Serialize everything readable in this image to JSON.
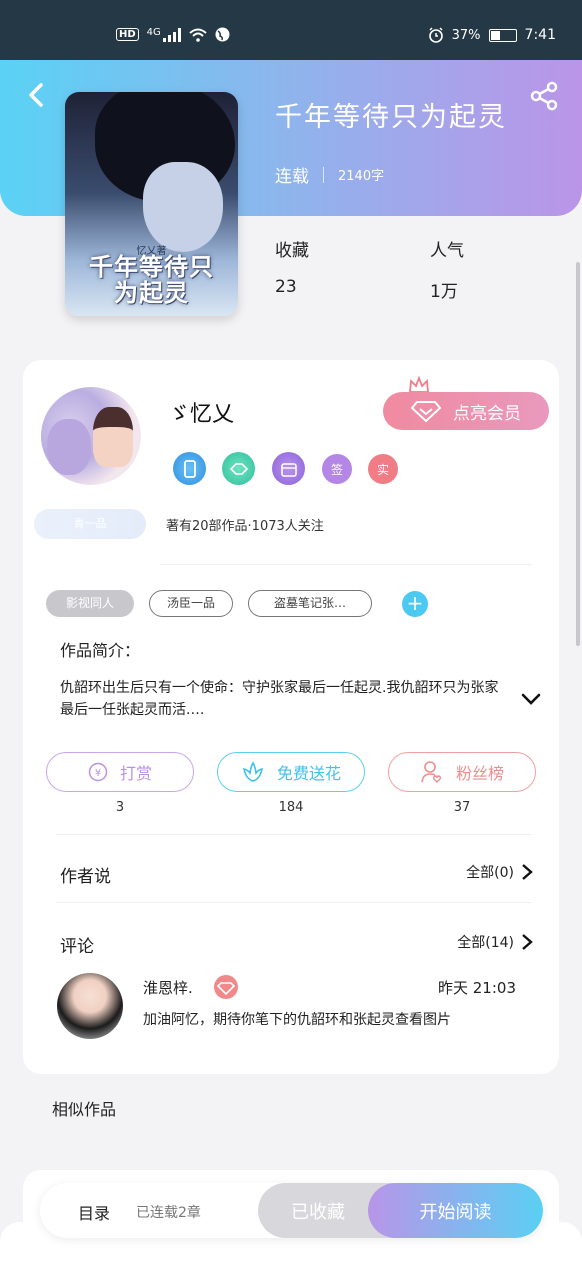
{
  "status_bar": {
    "hd": "HD",
    "network": "4G",
    "battery": "37%",
    "time": "7:41"
  },
  "book": {
    "title": "千年等待只为起灵",
    "status": "连载",
    "word_count": "2140字",
    "cover_small_text": "忆乂著",
    "cover_title": "千年等待只为起灵",
    "stats": [
      {
        "label": "收藏",
        "value": "23"
      },
      {
        "label": "人气",
        "value": "1万"
      }
    ]
  },
  "author": {
    "name": "ゞ忆乂",
    "vip_button": "点亮会员",
    "medals": [
      "签",
      "实"
    ],
    "level_badge": "青一品",
    "summary": "著有20部作品·1073人关注"
  },
  "tags": [
    "影视同人",
    "汤臣一品",
    "盗墓笔记张…"
  ],
  "intro": {
    "label": "作品简介：",
    "text": "仇韶环出生后只有一个使命：守护张家最后一任起灵.我仇韶环只为张家最后一任张起灵而活.…"
  },
  "actions": [
    {
      "label": "打赏",
      "count": "3"
    },
    {
      "label": "免费送花",
      "count": "184"
    },
    {
      "label": "粉丝榜",
      "count": "37"
    }
  ],
  "author_says": {
    "label": "作者说",
    "link": "全部(0)"
  },
  "comments": {
    "label": "评论",
    "link": "全部(14)",
    "items": [
      {
        "name": "淮恩梓.",
        "time": "昨天 21:03",
        "text": "加油阿忆，期待你笔下的仇韶环和张起灵查看图片"
      }
    ]
  },
  "similar": {
    "label": "相似作品"
  },
  "bottom_bar": {
    "toc": "目录",
    "chapters": "已连载2章",
    "collected": "已收藏",
    "read": "开始阅读"
  },
  "colors": {
    "accent_blue": "#5ad2f5",
    "accent_purple": "#bb95e8",
    "vip_pink": "#f08aa0"
  }
}
